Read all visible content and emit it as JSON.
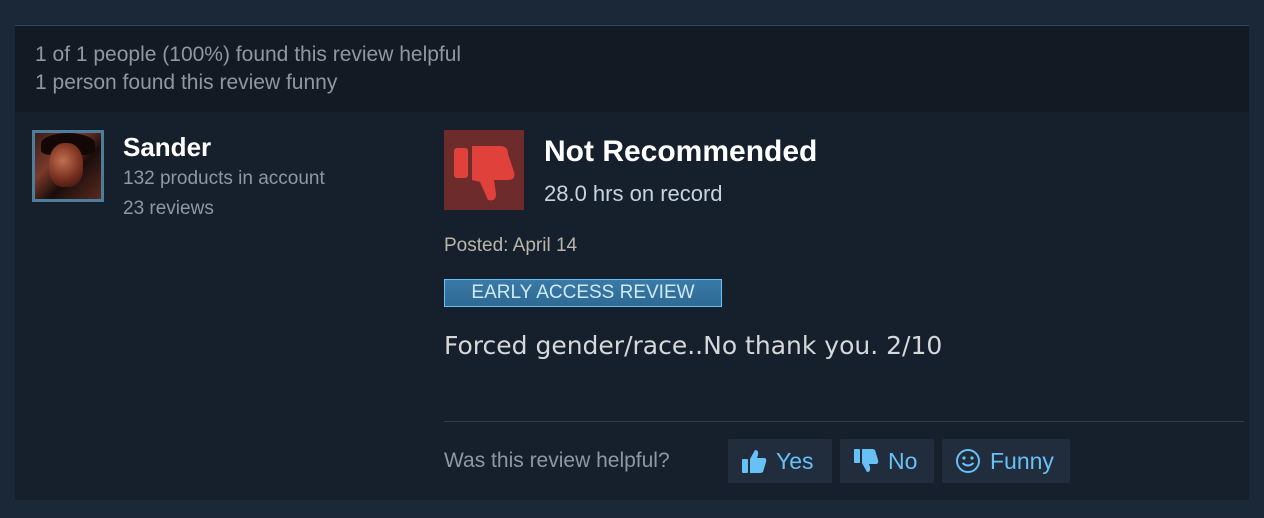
{
  "helpful_summary": {
    "helpful_line": "1 of 1 people (100%) found this review helpful",
    "funny_line": "1 person found this review funny"
  },
  "reviewer": {
    "name": "Sander",
    "products": "132 products in account",
    "reviews": "23 reviews"
  },
  "review": {
    "verdict": "Not Recommended",
    "hours": "28.0 hrs on record",
    "posted": "Posted: April 14",
    "badge": "EARLY ACCESS REVIEW",
    "text": "Forced gender/race..No thank you. 2/10",
    "verdict_icon": "thumbs-down-icon",
    "verdict_color": "#e0413b"
  },
  "vote": {
    "question": "Was this review helpful?",
    "yes_label": "Yes",
    "no_label": "No",
    "funny_label": "Funny",
    "accent": "#67c1f5"
  }
}
